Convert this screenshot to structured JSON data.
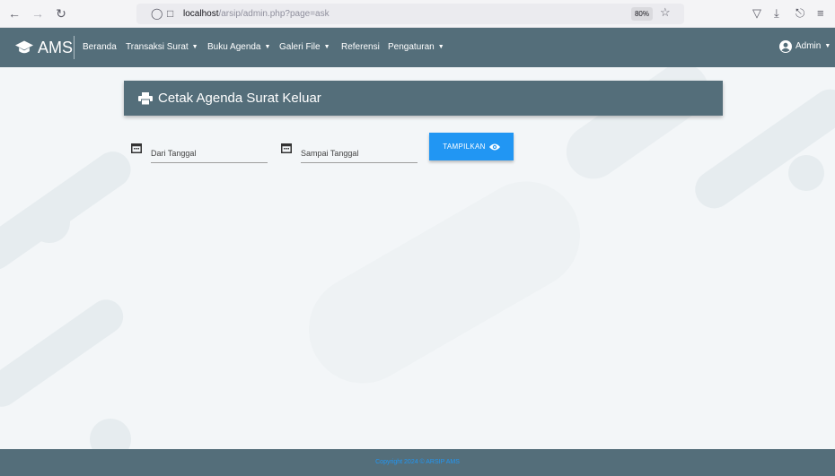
{
  "browser": {
    "url_host": "localhost",
    "url_path": "/arsip/admin.php?page=ask",
    "zoom": "80%"
  },
  "navbar": {
    "brand": "AMS",
    "items": [
      {
        "label": "Beranda",
        "dropdown": false
      },
      {
        "label": "Transaksi Surat",
        "dropdown": true
      },
      {
        "label": "Buku Agenda",
        "dropdown": true
      },
      {
        "label": "Galeri File",
        "dropdown": true
      },
      {
        "label": "Referensi",
        "dropdown": false
      },
      {
        "label": "Pengaturan",
        "dropdown": true
      }
    ],
    "user": "Admin"
  },
  "main": {
    "title": "Cetak Agenda Surat Keluar",
    "from_placeholder": "Dari Tanggal",
    "to_placeholder": "Sampai Tanggal",
    "show_button": "TAMPILKAN"
  },
  "footer": {
    "text": "Copyright 2024 © ARSIP AMS"
  },
  "colors": {
    "primary": "#546e7a",
    "accent": "#2196f3"
  }
}
